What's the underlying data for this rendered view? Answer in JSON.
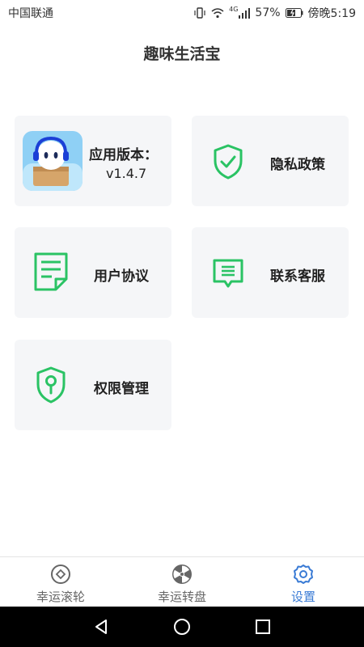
{
  "status_bar": {
    "carrier": "中国联通",
    "network": "4G",
    "battery": "57%",
    "time": "傍晚5:19"
  },
  "header": {
    "title": "趣味生活宝"
  },
  "cards": {
    "version": {
      "label": "应用版本：",
      "value": "v1.4.7",
      "icon": "app-mascot-icon"
    },
    "privacy": {
      "label": "隐私政策",
      "icon": "shield-check-icon"
    },
    "agreement": {
      "label": "用户协议",
      "icon": "document-icon"
    },
    "contact": {
      "label": "联系客服",
      "icon": "chat-bubble-icon"
    },
    "permissions": {
      "label": "权限管理",
      "icon": "shield-key-icon"
    }
  },
  "bottom_nav": {
    "items": [
      {
        "label": "幸运滚轮",
        "icon": "wheel-icon",
        "active": false
      },
      {
        "label": "幸运转盘",
        "icon": "spinner-icon",
        "active": false
      },
      {
        "label": "设置",
        "icon": "gear-icon",
        "active": true
      }
    ]
  },
  "colors": {
    "accent_green": "#2ac364",
    "active_blue": "#3a7bd5",
    "card_bg": "#f5f6f8"
  }
}
